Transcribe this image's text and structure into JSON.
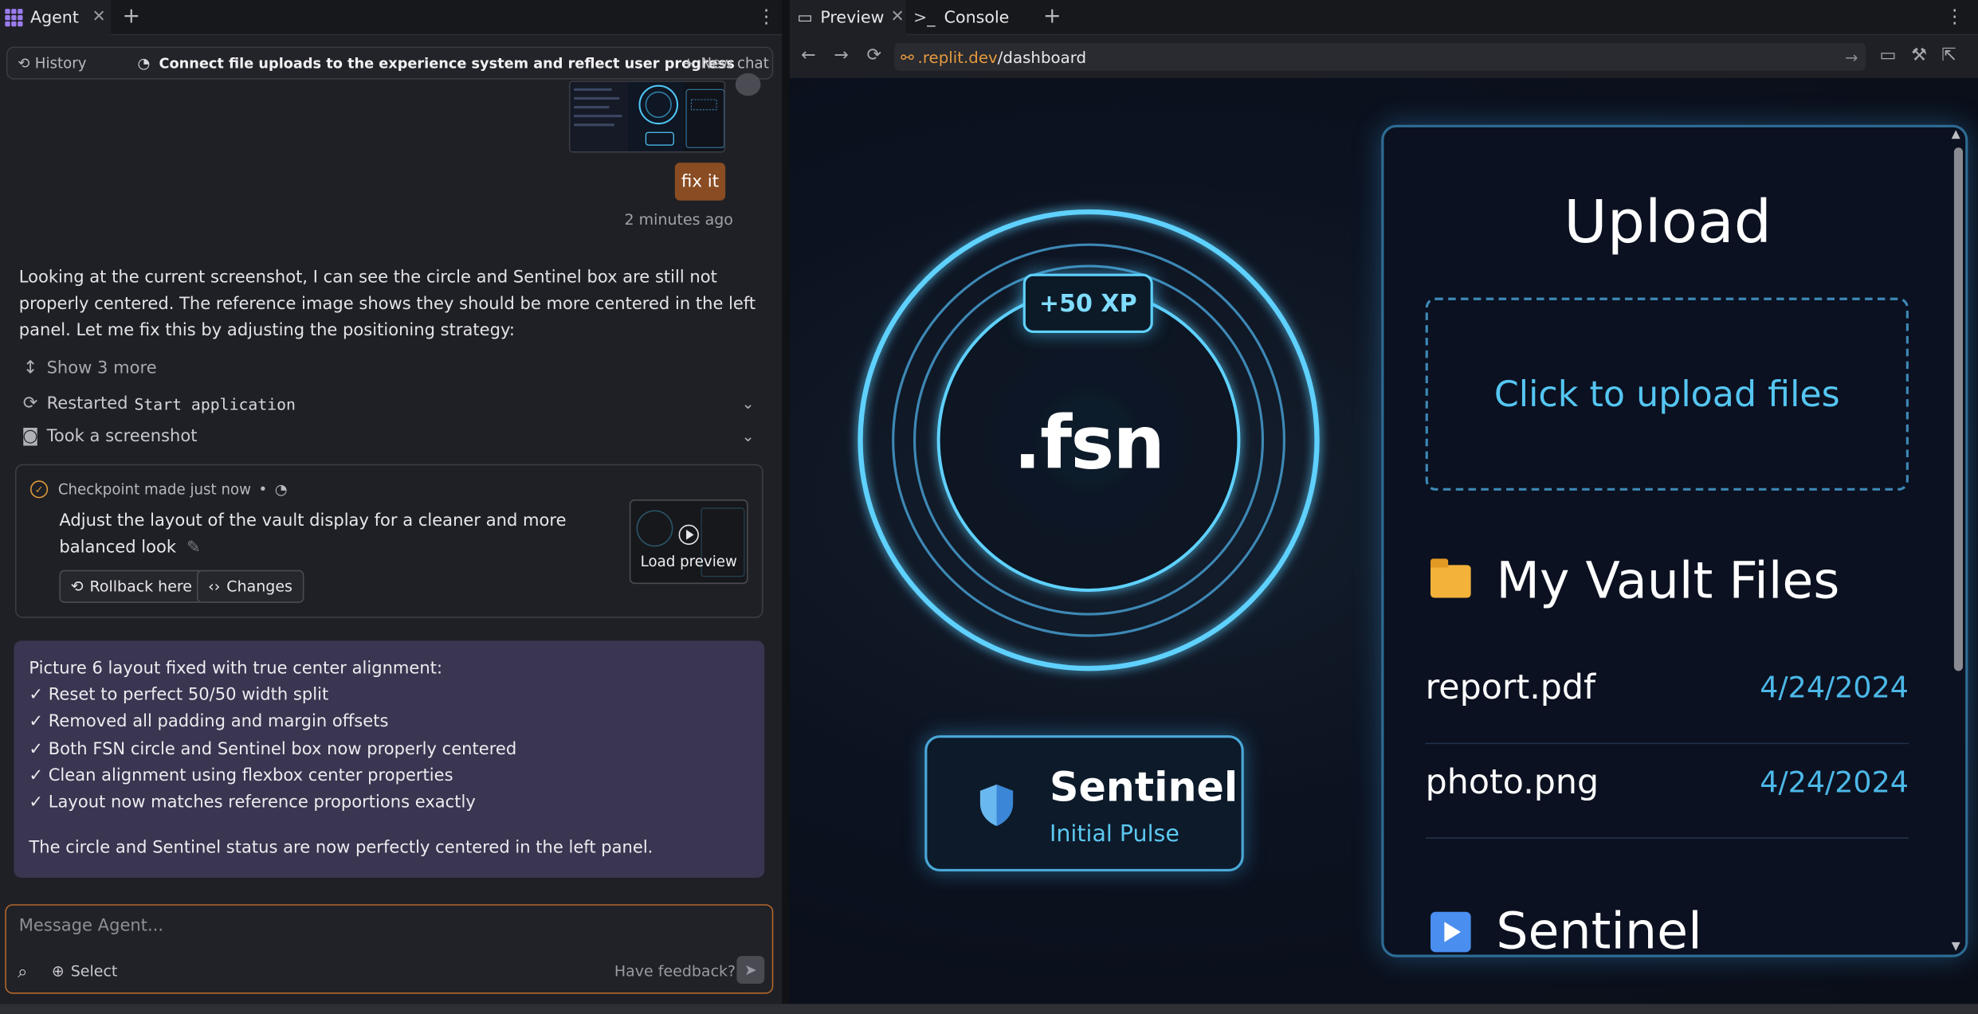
{
  "agent_tab": {
    "label": "Agent"
  },
  "header": {
    "history": "History",
    "title": "Connect file uploads to the experience system and reflect user progress",
    "new_chat": "New chat"
  },
  "user_message": {
    "text": "fix it",
    "time": "2 minutes ago"
  },
  "agent_message": {
    "text": "Looking at the current screenshot, I can see the circle and Sentinel box are still not properly centered. The reference image shows they should be more centered in the left panel. Let me fix this by adjusting the positioning strategy:"
  },
  "actions": {
    "show_more": "Show 3 more",
    "restarted": "Restarted",
    "restarted_target": "Start application",
    "screenshot": "Took a screenshot"
  },
  "checkpoint": {
    "head": "Checkpoint made just now",
    "description": "Adjust the layout of the vault display for a cleaner and more balanced look",
    "rollback": "Rollback here",
    "changes": "Changes",
    "load_preview": "Load preview"
  },
  "summary": {
    "title": "Picture 6 layout fixed with true center alignment:",
    "items": [
      "✓ Reset to perfect 50/50 width split",
      "✓ Removed all padding and margin offsets",
      "✓ Both FSN circle and Sentinel box now properly centered",
      "✓ Clean alignment using flexbox center properties",
      "✓ Layout now matches reference proportions exactly"
    ],
    "footer": "The circle and Sentinel status are now perfectly centered in the left panel."
  },
  "composer": {
    "placeholder": "Message Agent...",
    "select": "Select",
    "feedback": "Have feedback?"
  },
  "preview_tabs": {
    "preview": "Preview",
    "console": "Console"
  },
  "url": {
    "host": ".replit.dev",
    "path": "/dashboard"
  },
  "app": {
    "xp": "+50 XP",
    "logo": ".fsn",
    "sentinel_title": "Sentinel",
    "sentinel_sub": "Initial Pulse",
    "upload_title": "Upload",
    "upload_zone": "Click to upload files",
    "vault_title": "My Vault Files",
    "files": [
      {
        "name": "report.pdf",
        "date": "4/24/2024"
      },
      {
        "name": "photo.png",
        "date": "4/24/2024"
      }
    ],
    "sentinel_section": "Sentinel"
  },
  "colors": {
    "accent": "#5fd1ff",
    "user_bubble": "#8a4c22",
    "summary_bg": "#3a3550",
    "url_host": "#e49a3e"
  }
}
